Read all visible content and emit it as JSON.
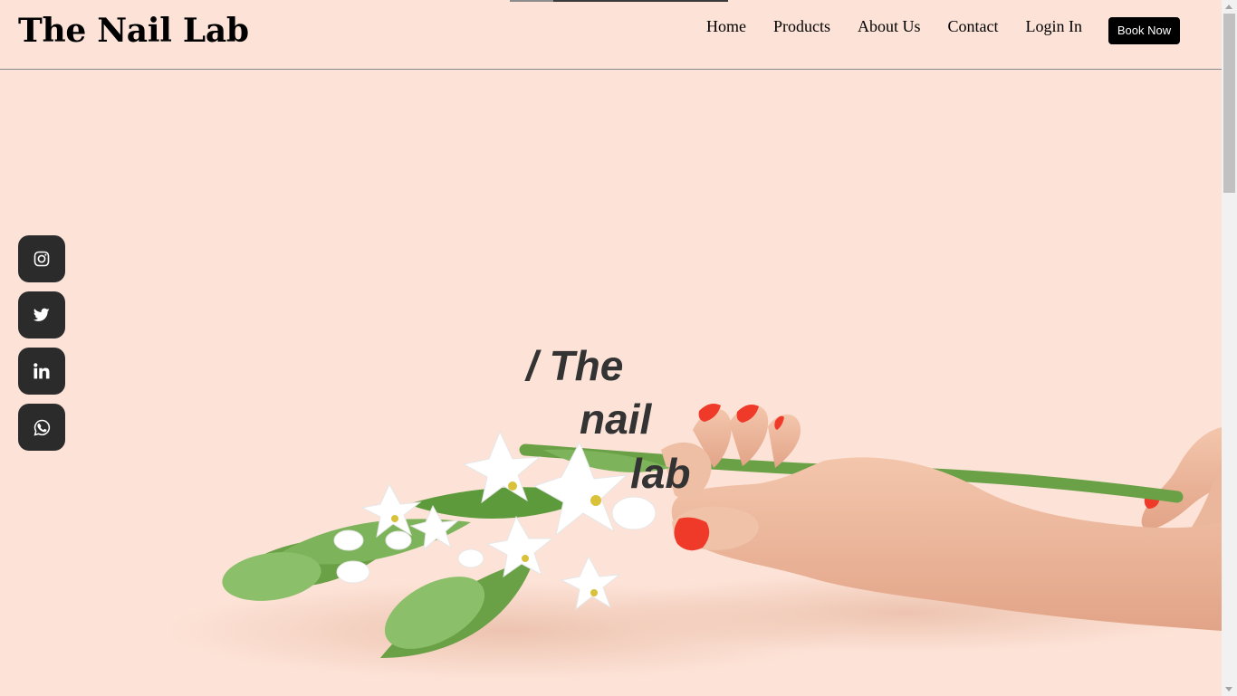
{
  "header": {
    "brand": "The Nail Lab",
    "nav": [
      "Home",
      "Products",
      "About Us",
      "Contact",
      "Login In"
    ],
    "cta_label": "Book Now"
  },
  "hero": {
    "title_lines": [
      "/ The",
      "nail",
      "lab"
    ],
    "image_subject": "hand with red nail polish holding white flowers"
  },
  "social": [
    "instagram-icon",
    "twitter-icon",
    "linkedin-icon",
    "whatsapp-icon"
  ],
  "colors": {
    "background": "#fde3d7",
    "text": "#000000",
    "hero_text": "#333333",
    "social_bg": "#2b2b2b",
    "button_bg": "#000000",
    "nail_red": "#ef3a2a"
  }
}
